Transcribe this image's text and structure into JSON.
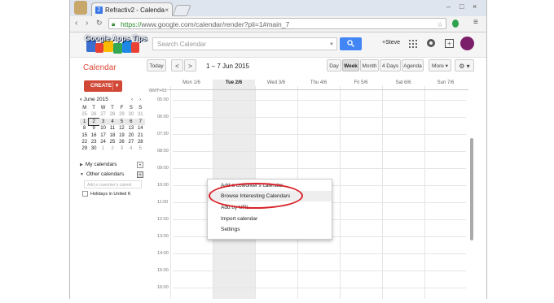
{
  "browser": {
    "tab_title": "Refractiv2 - Calenda",
    "tab_close": "×",
    "address_scheme": "https://",
    "address_rest": "www.google.com/calendar/render?pli=1#main_7"
  },
  "header": {
    "logo_text": "Google Apps Tips",
    "search_placeholder": "Search Calendar",
    "user": "+Steve",
    "accent": "#4285f4"
  },
  "toolbar": {
    "app_title": "Calendar",
    "today": "Today",
    "prev": "<",
    "next": ">",
    "date_label": "1 – 7 Jun 2015",
    "views": [
      "Day",
      "Week",
      "Month",
      "4 Days",
      "Agenda"
    ],
    "active_view": "Week",
    "more": "More ▾",
    "settings": "⚙ ▾"
  },
  "sidebar": {
    "create_label": "CREATE",
    "create_color": "#d14836",
    "minical": {
      "month": "June 2015",
      "weekdays": [
        "M",
        "T",
        "W",
        "T",
        "F",
        "S",
        "S"
      ],
      "rows": [
        [
          "25",
          "26",
          "27",
          "28",
          "29",
          "30",
          "31"
        ],
        [
          "1",
          "2",
          "3",
          "4",
          "5",
          "6",
          "7"
        ],
        [
          "8",
          "9",
          "10",
          "11",
          "12",
          "13",
          "14"
        ],
        [
          "15",
          "16",
          "17",
          "18",
          "19",
          "20",
          "21"
        ],
        [
          "22",
          "23",
          "24",
          "25",
          "26",
          "27",
          "28"
        ],
        [
          "29",
          "30",
          "1",
          "2",
          "3",
          "4",
          "5"
        ]
      ]
    },
    "my_calendars": "My calendars",
    "other_calendars": "Other calendars",
    "add_coworker_placeholder": "Add a coworker's calend",
    "holidays": "Holidays in United K"
  },
  "week": {
    "days": [
      "Mon 1/6",
      "Tue 2/6",
      "Wed 3/6",
      "Thu 4/6",
      "Fri 5/6",
      "Sat 6/6",
      "Sun 7/6"
    ],
    "timezone": "GMT+01",
    "times": [
      "05:00",
      "06:00",
      "07:00",
      "08:00",
      "09:00",
      "10:00",
      "11:00",
      "12:00",
      "13:00",
      "14:00",
      "15:00",
      "16:00"
    ]
  },
  "popup_menu": {
    "items": [
      "Add a coworker's calendar",
      "Browse Interesting Calendars",
      "Add by URL",
      "Import calendar",
      "Settings"
    ],
    "highlighted": "Browse Interesting Calendars",
    "highlight_color": "#d8232a"
  }
}
